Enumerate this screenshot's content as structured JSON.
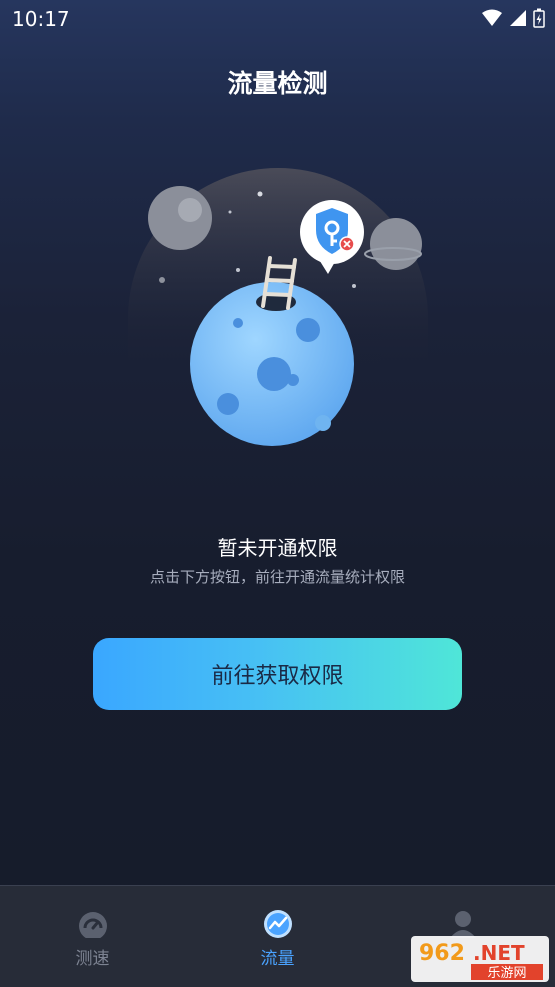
{
  "status_bar": {
    "time": "10:17"
  },
  "header": {
    "title": "流量检测"
  },
  "message": {
    "title": "暂未开通权限",
    "subtitle": "点击下方按钮，前往开通流量统计权限"
  },
  "cta": {
    "label": "前往获取权限"
  },
  "tabs": [
    {
      "label": "测速",
      "icon": "speedometer-icon",
      "active": false
    },
    {
      "label": "流量",
      "icon": "traffic-chart-icon",
      "active": true
    },
    {
      "label": "",
      "icon": "profile-icon",
      "active": false
    }
  ],
  "watermark": {
    "logo": "962.NET",
    "text": "乐游网"
  },
  "colors": {
    "accent": "#4aa3ff",
    "button_start": "#3aa7ff",
    "button_end": "#4fe6d8",
    "background": "#171d2e",
    "tab_bar": "#272c38"
  }
}
